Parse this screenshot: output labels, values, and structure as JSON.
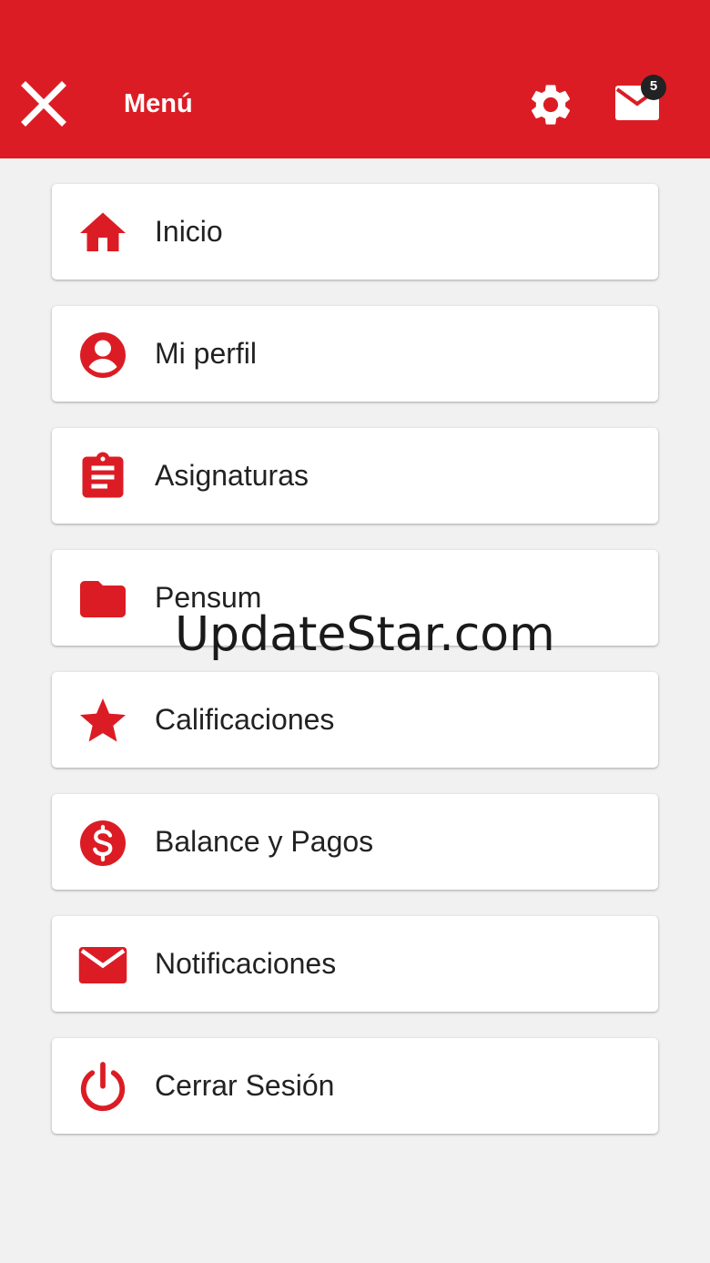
{
  "header": {
    "title": "Menú",
    "badge_count": "5",
    "background_color": "#dc1c24",
    "close_icon": "close-icon",
    "settings_icon": "gear-icon",
    "mail_icon": "mail-icon"
  },
  "menu": {
    "accent_color": "#dc1c24",
    "items": [
      {
        "label": "Inicio",
        "icon": "home-icon"
      },
      {
        "label": "Mi perfil",
        "icon": "profile-icon"
      },
      {
        "label": "Asignaturas",
        "icon": "clipboard-icon"
      },
      {
        "label": "Pensum",
        "icon": "folder-icon"
      },
      {
        "label": "Calificaciones",
        "icon": "star-icon"
      },
      {
        "label": "Balance y Pagos",
        "icon": "dollar-icon"
      },
      {
        "label": "Notificaciones",
        "icon": "mail-icon"
      },
      {
        "label": "Cerrar Sesión",
        "icon": "power-icon"
      }
    ]
  },
  "watermark": {
    "text": "UpdateStar.com"
  }
}
